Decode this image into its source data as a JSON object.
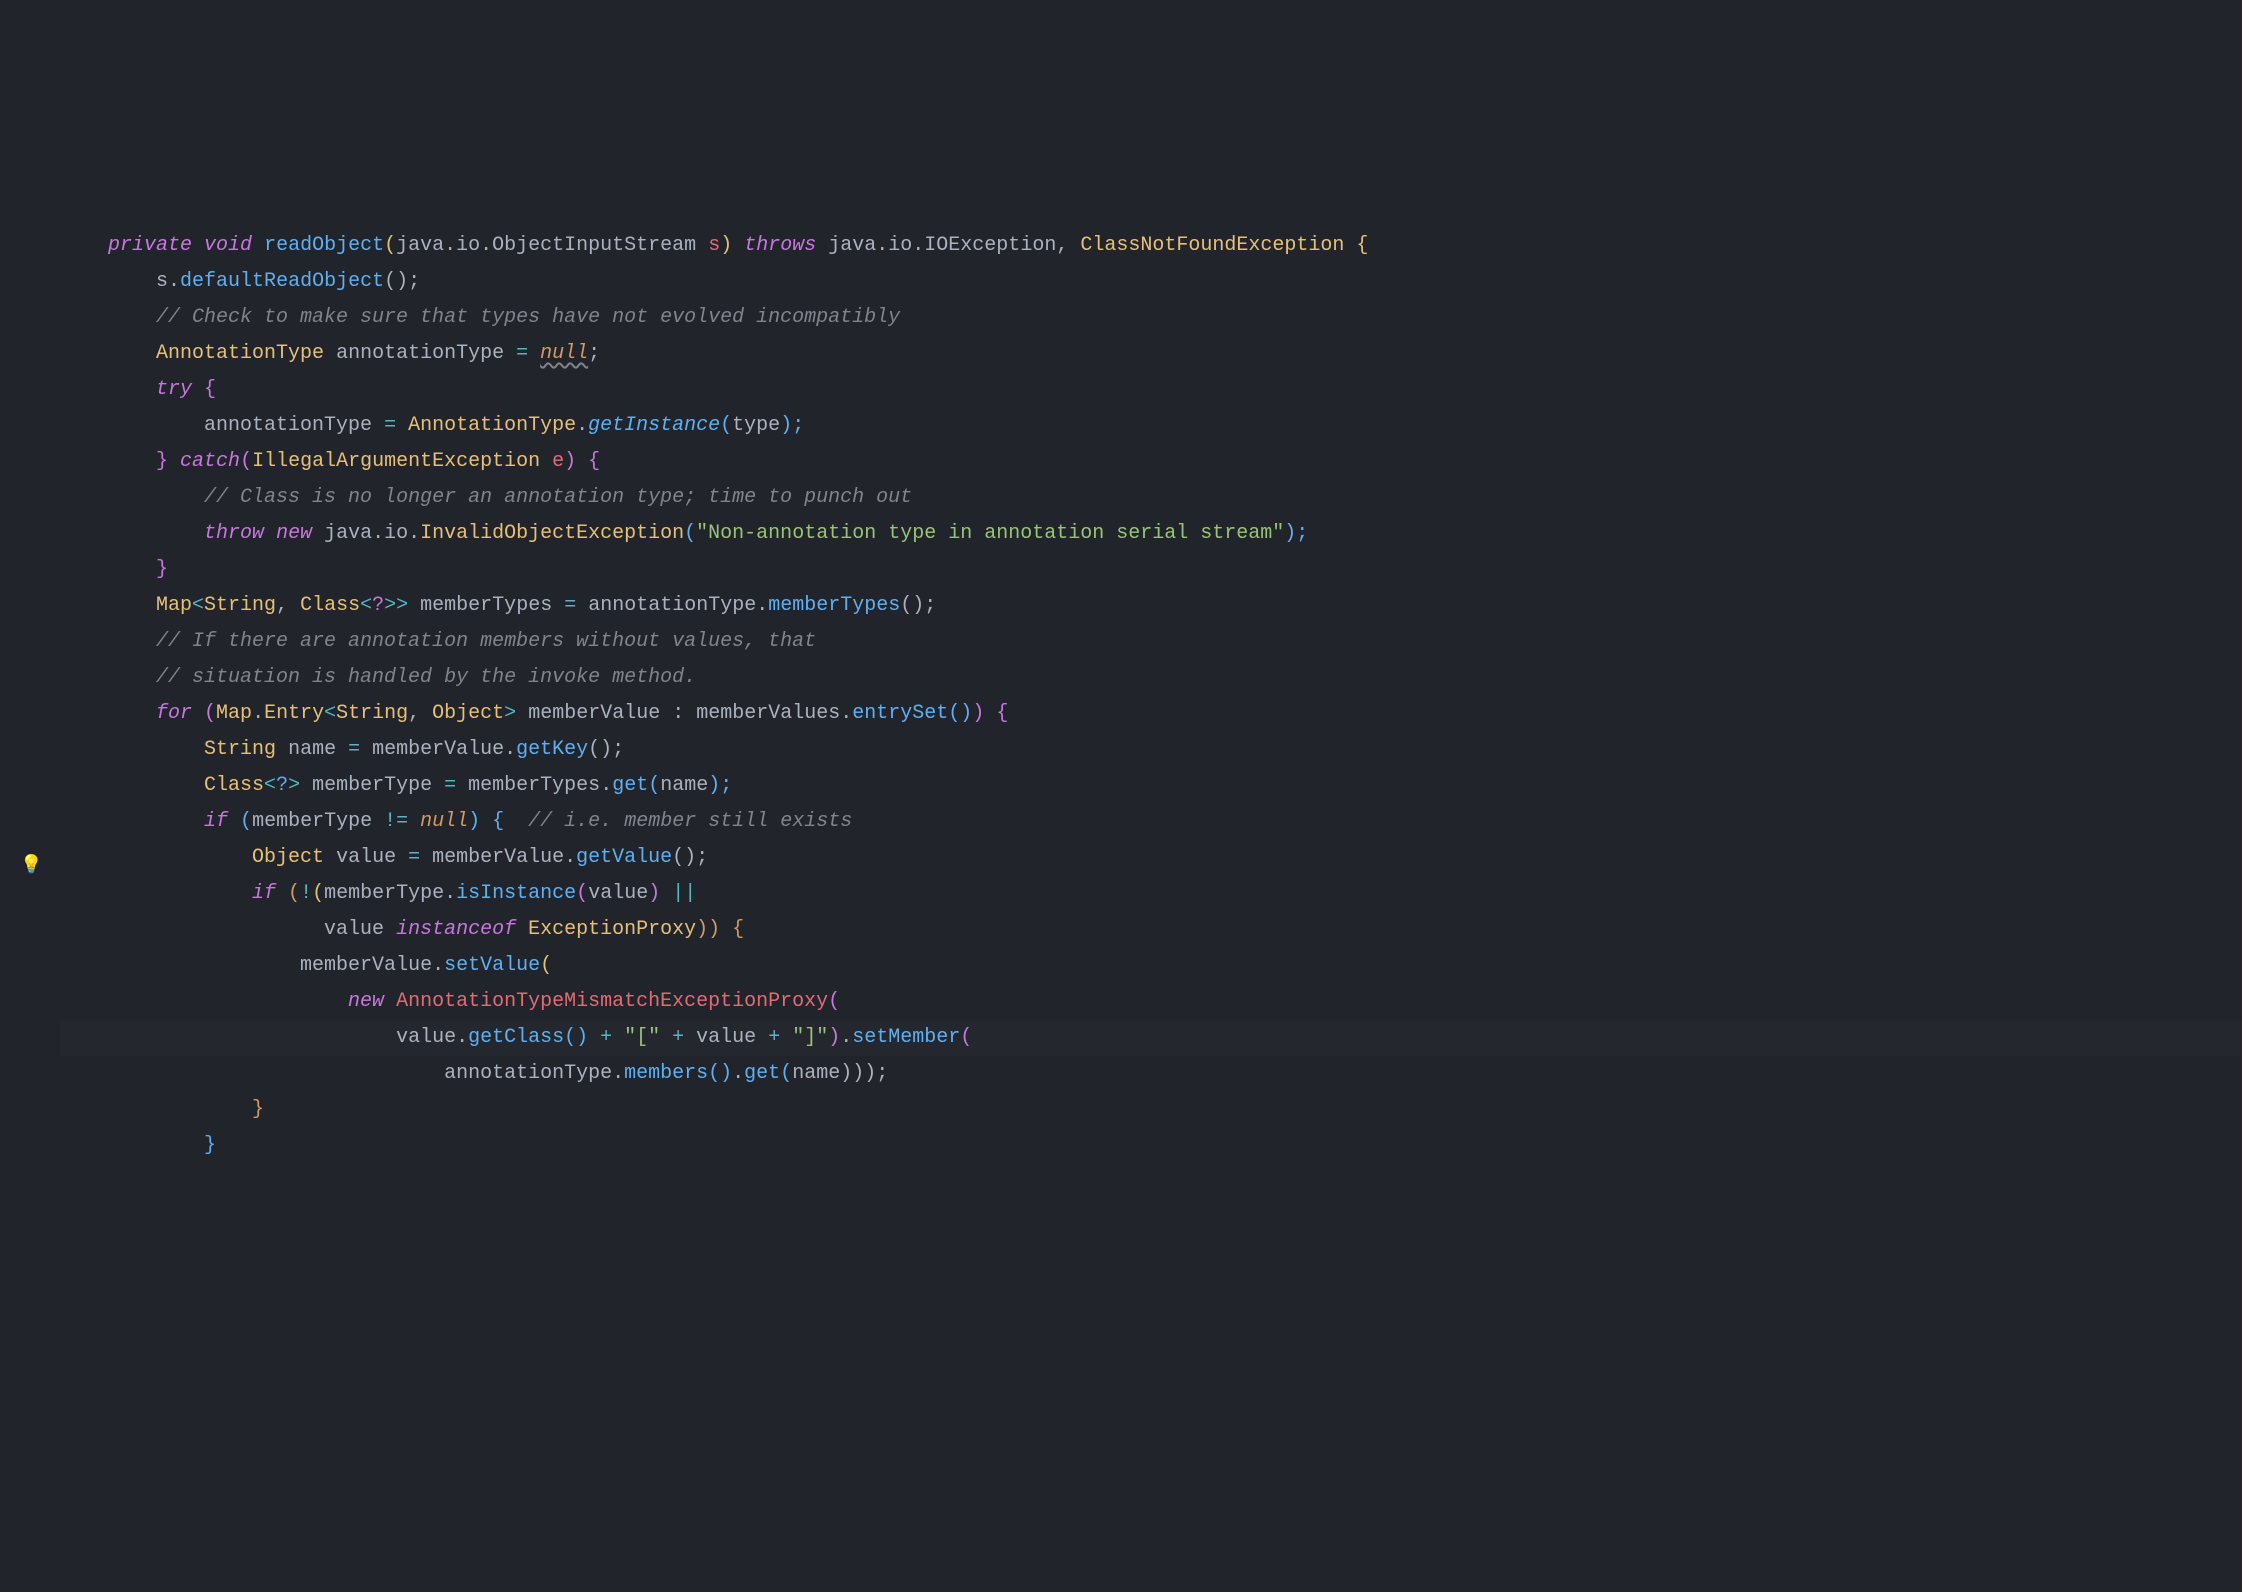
{
  "code": {
    "l1": {
      "prefix": "    ",
      "private": "private",
      "void": "void",
      "name": "readObject",
      "lp": "(",
      "param_type": "java.io.ObjectInputStream",
      "param": "s",
      "rp": ")",
      "throws": "throws",
      "ex1": "java.io.IOException",
      "comma": ", ",
      "ex2": "ClassNotFoundException",
      "ob": " {"
    },
    "l2": {
      "indent": "        ",
      "s": "s",
      "dot": ".",
      "call": "defaultReadObject",
      "tail": "();"
    },
    "l3": {
      "indent": "        ",
      "comment": "// Check to make sure that types have not evolved incompatibly"
    },
    "l4": {
      "indent": "        ",
      "type": "AnnotationType",
      "var": "annotationType",
      "eq": " = ",
      "null": "null",
      "semi": ";"
    },
    "l5": {
      "indent": "        ",
      "try": "try",
      "ob": " {"
    },
    "l6": {
      "indent": "            ",
      "var": "annotationType",
      "eq": " = ",
      "cls": "AnnotationType",
      "dot": ".",
      "call": "getInstance",
      "lp": "(",
      "arg": "type",
      "tail": ");"
    },
    "l7": {
      "indent": "        ",
      "cb": "}",
      "catch": "catch",
      "lp": "(",
      "extype": "IllegalArgumentException",
      "exvar": "e",
      "rp": ")",
      "ob": " {"
    },
    "l8": {
      "indent": "            ",
      "comment": "// Class is no longer an annotation type; time to punch out"
    },
    "l9": {
      "indent": "            ",
      "throw": "throw",
      "new": "new",
      "pkg": "java.io.",
      "ctor": "InvalidObjectException",
      "lp": "(",
      "str": "\"Non-annotation type in annotation serial stream\"",
      "tail": ");"
    },
    "l10": {
      "indent": "        ",
      "cb": "}"
    },
    "l11": {
      "indent": "        ",
      "map": "Map",
      "lt": "<",
      "s1": "String",
      "c1": ", ",
      "cls": "Class",
      "lt2": "<",
      "q": "?",
      "gt2": ">",
      "gt": ">",
      "var": "memberTypes",
      "eq": " = ",
      "obj": "annotationType",
      "dot": ".",
      "call": "memberTypes",
      "tail": "();"
    },
    "l12": {
      "indent": "        ",
      "comment": "// If there are annotation members without values, that"
    },
    "l13": {
      "indent": "        ",
      "comment": "// situation is handled by the invoke method."
    },
    "l14": {
      "indent": "        ",
      "for": "for",
      "lp": " (",
      "map": "Map",
      "dot": ".",
      "entry": "Entry",
      "lt": "<",
      "s1": "String",
      "c1": ", ",
      "obj": "Object",
      "gt": ">",
      "var": "memberValue",
      "colon": " : ",
      "src": "memberValues",
      "dot2": ".",
      "call": "entrySet",
      "rp": "()",
      "rp2": ")",
      "ob": " {"
    },
    "l15": {
      "indent": "            ",
      "type": "String",
      "var": "name",
      "eq": " = ",
      "obj": "memberValue",
      "dot": ".",
      "call": "getKey",
      "tail": "();"
    },
    "l16": {
      "indent": "            ",
      "cls": "Class",
      "lt": "<",
      "q": "?",
      "gt": ">",
      "var": "memberType",
      "eq": " = ",
      "obj": "memberTypes",
      "dot": ".",
      "call": "get",
      "lp": "(",
      "arg": "name",
      "tail": ");"
    },
    "l17": {
      "indent": "            ",
      "if": "if",
      "lp": " (",
      "var": "memberType",
      "neq": " != ",
      "null": "null",
      "rp": ")",
      "ob": " {",
      "sp": "  ",
      "comment": "// i.e. member still exists"
    },
    "l18": {
      "indent": "                ",
      "type": "Object",
      "var": "value",
      "eq": " = ",
      "obj": "memberValue",
      "dot": ".",
      "call": "getValue",
      "tail": "();"
    },
    "l19": {
      "indent": "                ",
      "if": "if",
      "lp": " (",
      "not": "!",
      "lp2": "(",
      "obj": "memberType",
      "dot": ".",
      "call": "isInstance",
      "lp3": "(",
      "arg": "value",
      "rp3": ")",
      "or": " ||"
    },
    "l20": {
      "indent": "                      ",
      "var": "value",
      "inst": "instanceof",
      "type": "ExceptionProxy",
      "rp": "))",
      "ob": " {"
    },
    "l21": {
      "indent": "                    ",
      "obj": "memberValue",
      "dot": ".",
      "call": "setValue",
      "lp": "("
    },
    "l22": {
      "indent": "                        ",
      "new": "new",
      "ctor": "AnnotationTypeMismatchExceptionProxy",
      "lp": "("
    },
    "l23": {
      "indent": "                            ",
      "obj": "value",
      "dot": ".",
      "call": "getClass",
      "lp": "()",
      "plus": " + ",
      "str1": "\"[\"",
      "plus2": " + ",
      "var": "value",
      "plus3": " + ",
      "str2": "\"]\"",
      "rp": ")",
      "dot2": ".",
      "call2": "setMember",
      "lp2": "("
    },
    "l24": {
      "indent": "                                ",
      "obj": "annotationType",
      "dot": ".",
      "call": "members",
      "lp": "()",
      "dot2": ".",
      "call2": "get",
      "lp2": "(",
      "arg": "name",
      "tail": ")));"
    },
    "l25": {
      "indent": "                ",
      "cb": "}"
    },
    "l26": {
      "indent": "            ",
      "cb": "}"
    }
  }
}
